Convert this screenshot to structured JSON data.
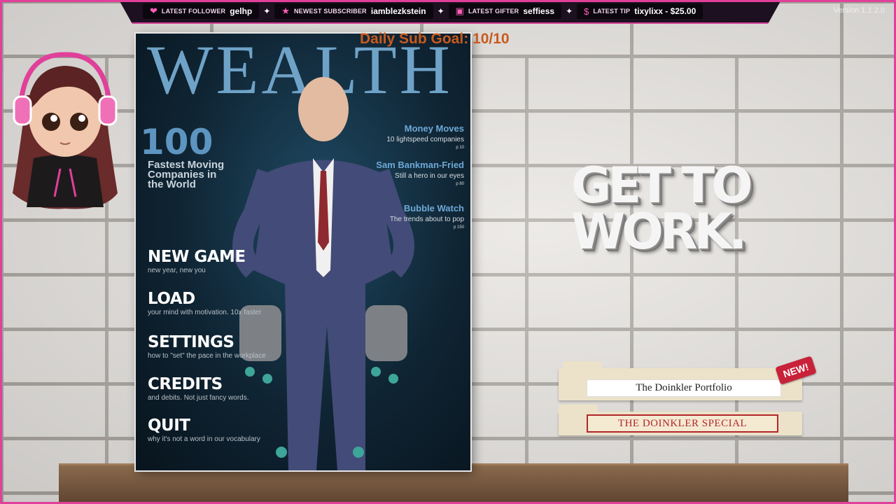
{
  "stream_overlay": {
    "latest_follower": {
      "label": "LATEST FOLLOWER",
      "value": "gelhp",
      "icon": "heart-icon"
    },
    "newest_subscriber": {
      "label": "NEWEST SUBSCRIBER",
      "value": "iamblezkstein",
      "icon": "star-icon"
    },
    "latest_gifter": {
      "label": "LATEST GIFTER",
      "value": "seffiess",
      "icon": "gift-icon"
    },
    "latest_tip": {
      "label": "LATEST TIP",
      "value": "tixylixx - $25.00",
      "icon": "dollar-icon"
    },
    "separator": "✦",
    "daily_sub_goal": "Daily Sub Goal: 10/10",
    "accent_color": "#e0409a"
  },
  "version": "Version 1.1.2.0",
  "magazine": {
    "title": "WEALTH",
    "feature_number": "100",
    "feature_text": "Fastest Moving Companies in the World",
    "headlines": [
      {
        "title": "Money Moves",
        "subtitle": "10 lightspeed companies",
        "page": "p 10"
      },
      {
        "title": "Sam Bankman-Fried",
        "subtitle": "Still a hero in our eyes",
        "page": "p 80"
      },
      {
        "title": "Bubble Watch",
        "subtitle": "The trends about to pop",
        "page": "p 150"
      }
    ]
  },
  "menu": [
    {
      "label": "NEW GAME",
      "subtitle": "new year, new you"
    },
    {
      "label": "LOAD",
      "subtitle": "your mind with motivation. 10x faster"
    },
    {
      "label": "SETTINGS",
      "subtitle": "how to \"set\" the pace in the workplace"
    },
    {
      "label": "CREDITS",
      "subtitle": "and debits. Not just fancy words."
    },
    {
      "label": "QUIT",
      "subtitle": "why it's not a word in our vocabulary"
    }
  ],
  "tagline": {
    "line1": "GET TO",
    "line2": "WORK."
  },
  "folders": {
    "portfolio": "The Doinkler Portfolio",
    "special": "THE DOINKLER SPECIAL",
    "new_badge": "NEW!"
  }
}
